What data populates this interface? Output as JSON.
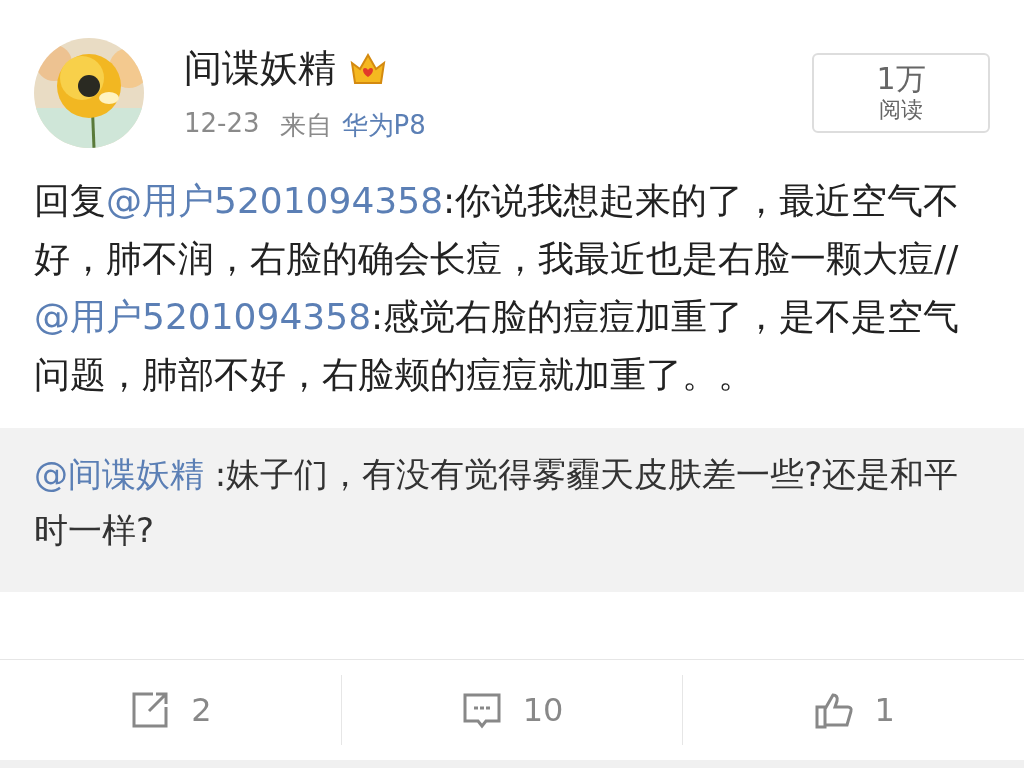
{
  "post": {
    "author": "间谍妖精",
    "date": "12-23",
    "source_prefix": "来自",
    "source": "华为P8",
    "reads": {
      "count": "1万",
      "label": "阅读"
    },
    "text": [
      {
        "kind": "plain",
        "text": "回复"
      },
      {
        "kind": "mention",
        "text": "@用户5201094358"
      },
      {
        "kind": "plain",
        "text": ":你说我想起来的了，最近空气不好，肺不润，右脸的确会长痘，我最近也是右脸一颗大痘//"
      },
      {
        "kind": "mention",
        "text": "@用户5201094358"
      },
      {
        "kind": "plain",
        "text": ":感觉右脸的痘痘加重了，是不是空气问题，肺部不好，右脸颊的痘痘就加重了。。"
      }
    ]
  },
  "quoted": {
    "text": [
      {
        "kind": "mention",
        "text": "@间谍妖精"
      },
      {
        "kind": "plain",
        "text": " :妹子们，有没有觉得雾霾天皮肤差一些?还是和平时一样?"
      }
    ]
  },
  "actions": [
    {
      "kind": "repost",
      "count": "2"
    },
    {
      "kind": "comment",
      "count": "10"
    },
    {
      "kind": "like",
      "count": "1"
    }
  ]
}
